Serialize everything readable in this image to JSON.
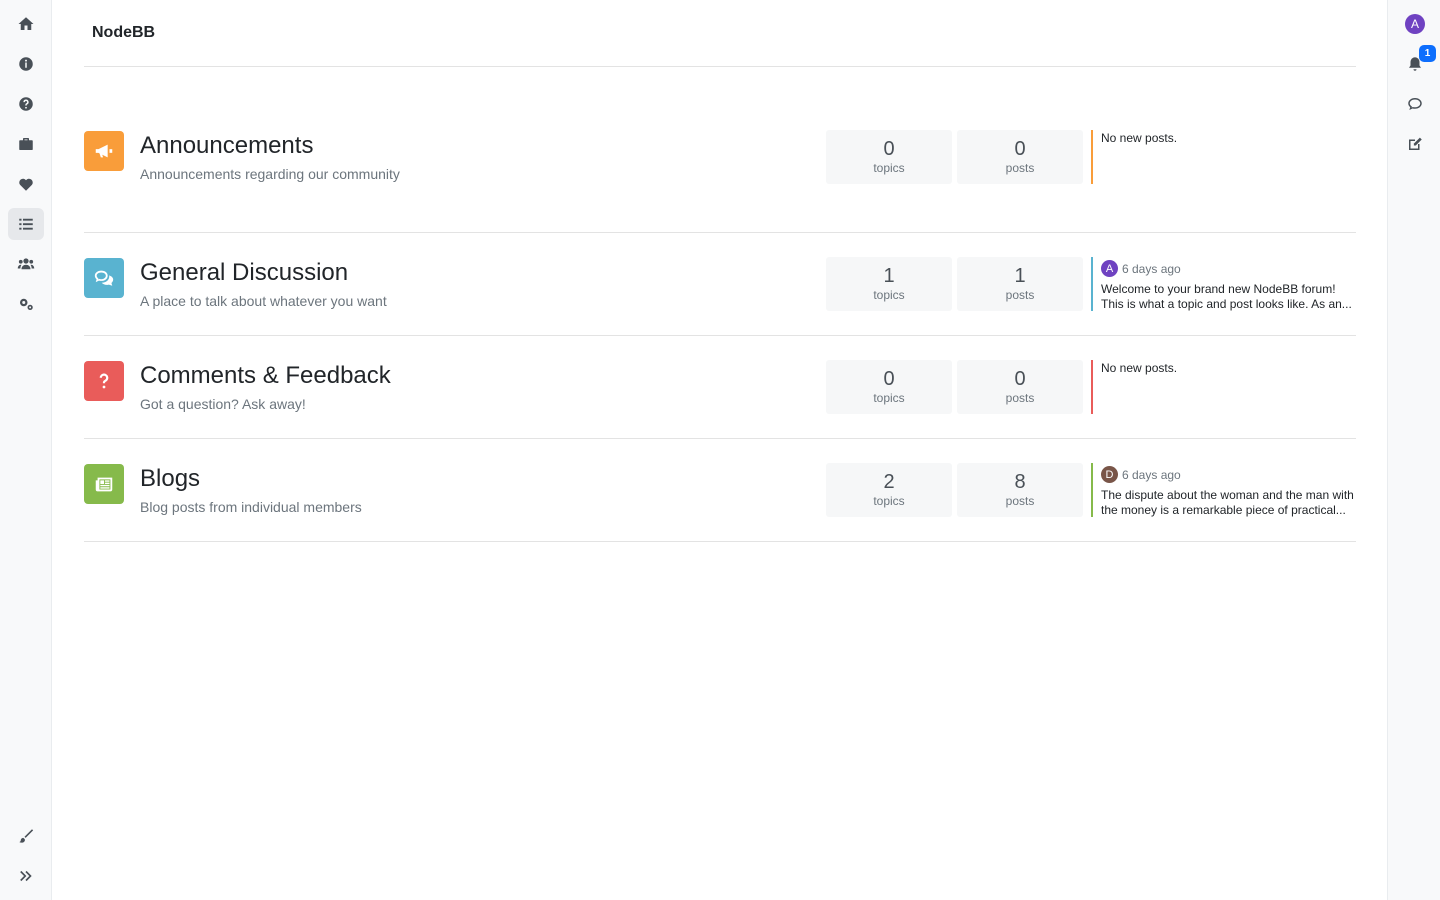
{
  "brand": "NodeBB",
  "left_nav": [
    "home-icon",
    "info-icon",
    "help-icon",
    "briefcase-icon",
    "heart-icon",
    "list-icon",
    "users-icon",
    "gears-icon"
  ],
  "left_bottom": [
    "paintbrush-icon",
    "expand-icon"
  ],
  "user": {
    "initial": "A",
    "avatar_color": "#6f42c1"
  },
  "notifications": {
    "count": "1"
  },
  "categories": [
    {
      "title": "Announcements",
      "description": "Announcements regarding our community",
      "icon": "bullhorn-icon",
      "color": "#f99d3a",
      "topics": "0",
      "topics_label": "topics",
      "posts": "0",
      "posts_label": "posts",
      "teaser": {
        "none": "No new posts."
      }
    },
    {
      "title": "General Discussion",
      "description": "A place to talk about whatever you want",
      "icon": "comments-icon",
      "color": "#59b3d0",
      "topics": "1",
      "topics_label": "topics",
      "posts": "1",
      "posts_label": "posts",
      "teaser": {
        "avatar": "A",
        "avatar_color": "#6f42c1",
        "time": "6 days ago",
        "line1": "Welcome to your brand new NodeBB forum!",
        "line2": "This is what a topic and post looks like. As an..."
      }
    },
    {
      "title": "Comments & Feedback",
      "description": "Got a question? Ask away!",
      "icon": "question-icon",
      "color": "#e95c5a",
      "topics": "0",
      "topics_label": "topics",
      "posts": "0",
      "posts_label": "posts",
      "teaser": {
        "none": "No new posts."
      }
    },
    {
      "title": "Blogs",
      "description": "Blog posts from individual members",
      "icon": "newspaper-icon",
      "color": "#86ba4b",
      "topics": "2",
      "topics_label": "topics",
      "posts": "8",
      "posts_label": "posts",
      "teaser": {
        "avatar": "D",
        "avatar_color": "#795548",
        "time": "6 days ago",
        "line1": "The dispute about the woman and the man with",
        "line2": "the money is a remarkable piece of practical..."
      }
    }
  ]
}
